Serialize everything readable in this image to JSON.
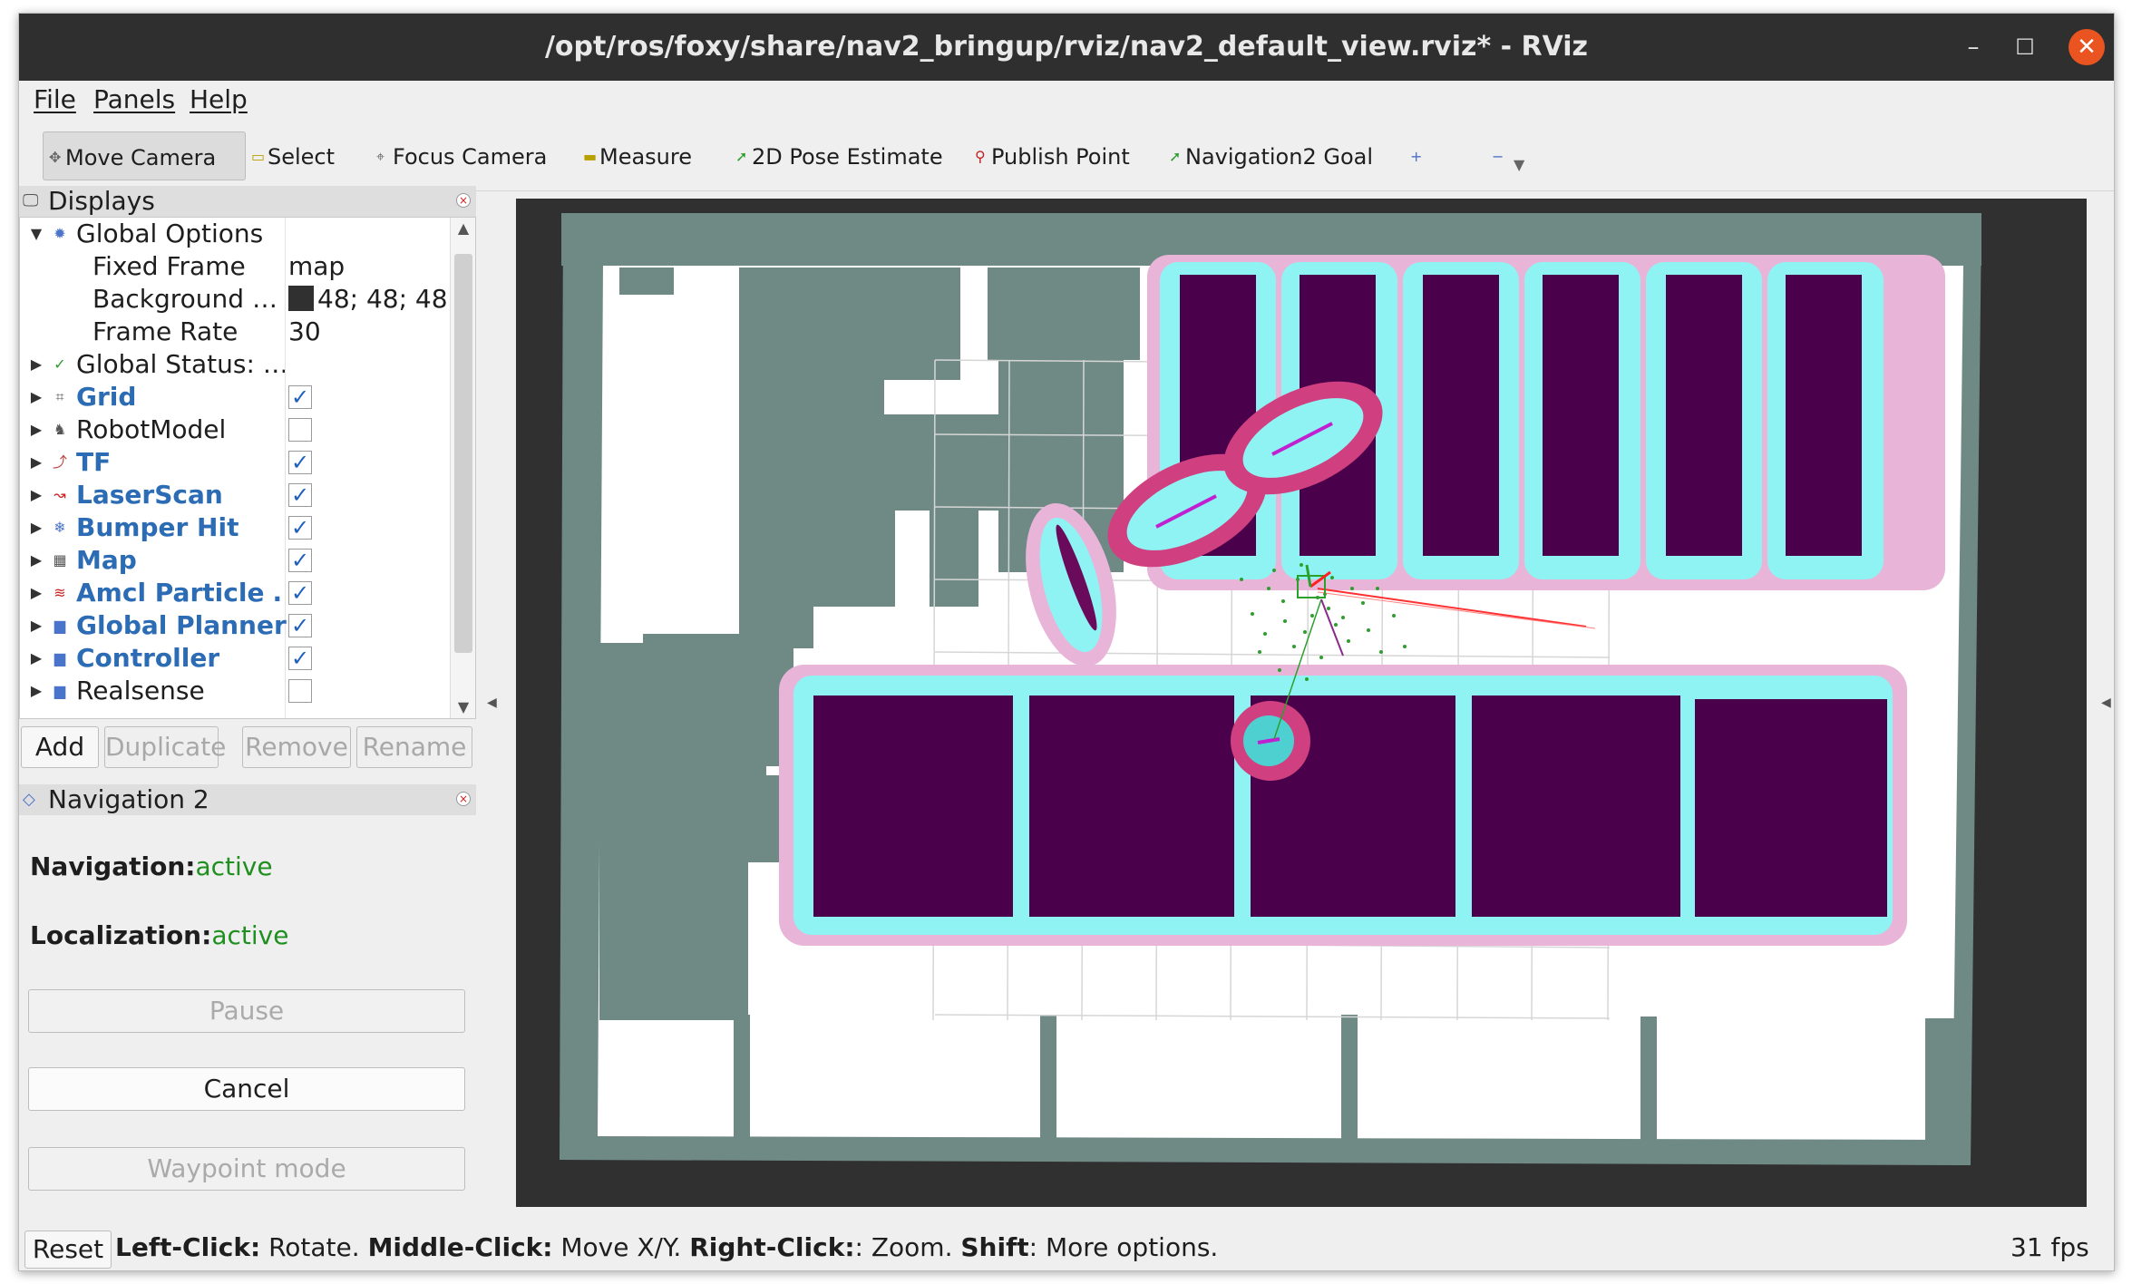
{
  "window": {
    "title": "/opt/ros/foxy/share/nav2_bringup/rviz/nav2_default_view.rviz* - RViz",
    "min_glyph": "–",
    "max_glyph": "☐",
    "close_glyph": "✕"
  },
  "menu": {
    "file": "File",
    "panels": "Panels",
    "help": "Help"
  },
  "toolbar": {
    "move_camera": "Move Camera",
    "select": "Select",
    "focus_camera": "Focus Camera",
    "measure": "Measure",
    "pose_estimate": "2D Pose Estimate",
    "publish_point": "Publish Point",
    "nav_goal": "Navigation2 Goal",
    "plus_glyph": "+",
    "minus_glyph": "−",
    "dropdown_glyph": "▼"
  },
  "displays": {
    "title": "Displays",
    "close_glyph": "×",
    "global_options": {
      "label": "Global Options",
      "fixed_frame_label": "Fixed Frame",
      "fixed_frame_value": "map",
      "background_label": "Background …",
      "background_value": "48; 48; 48",
      "background_color": "#303030",
      "frame_rate_label": "Frame Rate",
      "frame_rate_value": "30"
    },
    "global_status": "Global Status: …",
    "items": [
      {
        "label": "Grid",
        "checked": true,
        "icon": "grid-icon"
      },
      {
        "label": "RobotModel",
        "checked": false,
        "icon": "robot-model-icon"
      },
      {
        "label": "TF",
        "checked": true,
        "icon": "tf-icon"
      },
      {
        "label": "LaserScan",
        "checked": true,
        "icon": "laserscan-icon"
      },
      {
        "label": "Bumper Hit",
        "checked": true,
        "icon": "bumper-icon"
      },
      {
        "label": "Map",
        "checked": true,
        "icon": "map-icon"
      },
      {
        "label": "Amcl Particle …",
        "checked": true,
        "icon": "amcl-icon"
      },
      {
        "label": "Global Planner",
        "checked": true,
        "icon": "folder-icon"
      },
      {
        "label": "Controller",
        "checked": true,
        "icon": "folder-icon"
      },
      {
        "label": "Realsense",
        "checked": false,
        "icon": "folder-icon"
      }
    ],
    "check_glyph": "✓",
    "buttons": {
      "add": "Add",
      "duplicate": "Duplicate",
      "remove": "Remove",
      "rename": "Rename"
    }
  },
  "navigation": {
    "title": "Navigation 2",
    "close_glyph": "×",
    "navigation_label": "Navigation:",
    "navigation_value": "active",
    "localization_label": "Localization:",
    "localization_value": "active",
    "pause": "Pause",
    "cancel": "Cancel",
    "waypoint": "Waypoint mode"
  },
  "statusbar": {
    "reset": "Reset",
    "left_click_key": "Left-Click:",
    "left_click_text": " Rotate. ",
    "middle_click_key": "Middle-Click:",
    "middle_click_text": " Move X/Y. ",
    "right_click_key": "Right-Click:",
    "right_click_text": ": Zoom. ",
    "shift_key": "Shift",
    "shift_text": ": More options.",
    "fps": "31 fps"
  },
  "colors": {
    "map_obstacle": "#6f8a84",
    "costmap_lethal": "#4a004a",
    "costmap_inflation": "#8ff3f3",
    "costmap_outer": "#e8b4d8",
    "status_active": "#1f8f1f",
    "checkbox_blue": "#1e5fbf",
    "titlebar": "#2f2f2f",
    "close_button": "#e95420"
  }
}
